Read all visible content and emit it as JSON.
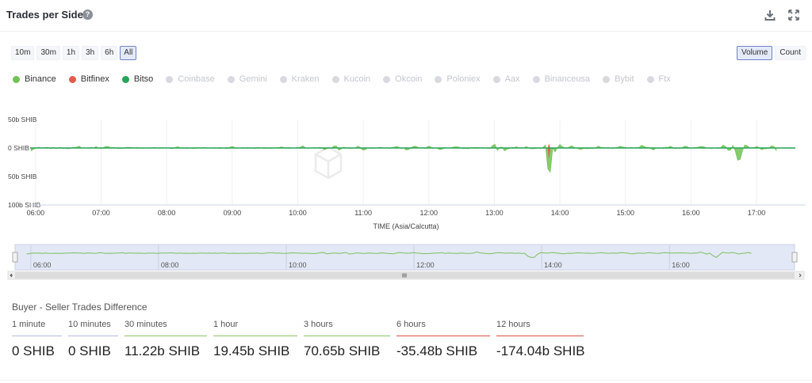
{
  "header": {
    "title": "Trades per Side",
    "help_icon": "question-circle-icon",
    "download_icon": "download-icon",
    "expand_icon": "expand-icon"
  },
  "timeframes": [
    {
      "label": "10m",
      "active": false
    },
    {
      "label": "30m",
      "active": false
    },
    {
      "label": "1h",
      "active": false
    },
    {
      "label": "3h",
      "active": false
    },
    {
      "label": "6h",
      "active": false
    },
    {
      "label": "All",
      "active": true
    }
  ],
  "modes": [
    {
      "label": "Volume",
      "active": true
    },
    {
      "label": "Count",
      "active": false
    }
  ],
  "legend": [
    {
      "name": "Binance",
      "color": "#72c255",
      "active": true
    },
    {
      "name": "Bitfinex",
      "color": "#e05c4b",
      "active": true
    },
    {
      "name": "Bitso",
      "color": "#27a459",
      "active": true
    },
    {
      "name": "Coinbase",
      "color": "#d8dadf",
      "active": false
    },
    {
      "name": "Gemini",
      "color": "#d8dadf",
      "active": false
    },
    {
      "name": "Kraken",
      "color": "#d8dadf",
      "active": false
    },
    {
      "name": "Kucoin",
      "color": "#d8dadf",
      "active": false
    },
    {
      "name": "Okcoin",
      "color": "#d8dadf",
      "active": false
    },
    {
      "name": "Poloniex",
      "color": "#d8dadf",
      "active": false
    },
    {
      "name": "Aax",
      "color": "#d8dadf",
      "active": false
    },
    {
      "name": "Binanceusa",
      "color": "#d8dadf",
      "active": false
    },
    {
      "name": "Bybit",
      "color": "#d8dadf",
      "active": false
    },
    {
      "name": "Ftx",
      "color": "#d8dadf",
      "active": false
    }
  ],
  "chart_data": {
    "type": "area",
    "title": "Trades per Side",
    "xlabel": "TIME (Asia/Calcutta)",
    "ylabel": "",
    "x_ticks": [
      "06:00",
      "07:00",
      "08:00",
      "09:00",
      "10:00",
      "11:00",
      "12:00",
      "13:00",
      "14:00",
      "15:00",
      "16:00",
      "17:00"
    ],
    "y_ticks": [
      "50b SHIB",
      "0 SHIB",
      "50b SHIB",
      "100b SHIB"
    ],
    "y_tick_values": [
      50,
      0,
      -50,
      -100
    ],
    "ylim": [
      -100,
      50
    ],
    "unit": "b SHIB",
    "xlim": [
      "05:55",
      "17:45"
    ],
    "data_end": "17:19",
    "grid": true,
    "series": [
      {
        "name": "Binance",
        "color": "#72c255",
        "baseline_noise_b": 1.2,
        "events": [
          {
            "time": "05:56",
            "value": -5
          },
          {
            "time": "06:40",
            "value": 2.5
          },
          {
            "time": "06:55",
            "value": 2
          },
          {
            "time": "07:05",
            "value": 2.5
          },
          {
            "time": "07:25",
            "value": 2.2
          },
          {
            "time": "08:10",
            "value": 2
          },
          {
            "time": "09:00",
            "value": 2
          },
          {
            "time": "09:45",
            "value": 3
          },
          {
            "time": "10:05",
            "value": 2.8
          },
          {
            "time": "10:25",
            "value": -3.5
          },
          {
            "time": "10:35",
            "value": 5
          },
          {
            "time": "10:38",
            "value": -5
          },
          {
            "time": "10:55",
            "value": 4
          },
          {
            "time": "11:00",
            "value": -5
          },
          {
            "time": "11:30",
            "value": 3.5
          },
          {
            "time": "11:40",
            "value": -4
          },
          {
            "time": "11:47",
            "value": 4
          },
          {
            "time": "12:00",
            "value": 3.5
          },
          {
            "time": "12:10",
            "value": -3
          },
          {
            "time": "12:25",
            "value": 3
          },
          {
            "time": "12:45",
            "value": 2
          },
          {
            "time": "13:00",
            "value": 10
          },
          {
            "time": "13:03",
            "value": -8
          },
          {
            "time": "13:05",
            "value": 5
          },
          {
            "time": "13:10",
            "value": -5
          },
          {
            "time": "13:20",
            "value": 3
          },
          {
            "time": "13:30",
            "value": 2.5
          },
          {
            "time": "13:49",
            "value": 25
          },
          {
            "time": "13:50",
            "value": -88
          },
          {
            "time": "13:52",
            "value": 8
          },
          {
            "time": "13:55",
            "value": -8
          },
          {
            "time": "14:00",
            "value": 5
          },
          {
            "time": "14:10",
            "value": 4
          },
          {
            "time": "14:20",
            "value": -3
          },
          {
            "time": "14:35",
            "value": 3
          },
          {
            "time": "14:55",
            "value": 3
          },
          {
            "time": "15:15",
            "value": 4
          },
          {
            "time": "15:25",
            "value": -3
          },
          {
            "time": "15:40",
            "value": 3
          },
          {
            "time": "15:55",
            "value": 5
          },
          {
            "time": "16:10",
            "value": 3
          },
          {
            "time": "16:30",
            "value": 7
          },
          {
            "time": "16:35",
            "value": -5
          },
          {
            "time": "16:40",
            "value": 8
          },
          {
            "time": "16:42",
            "value": -22
          },
          {
            "time": "16:45",
            "value": -18
          },
          {
            "time": "16:50",
            "value": 5
          },
          {
            "time": "17:00",
            "value": 4
          },
          {
            "time": "17:05",
            "value": -4
          },
          {
            "time": "17:15",
            "value": 5
          },
          {
            "time": "17:18",
            "value": -5
          }
        ]
      },
      {
        "name": "Bitfinex",
        "color": "#e05c4b",
        "events": [
          {
            "time": "13:50",
            "value": 8
          },
          {
            "time": "13:50",
            "value": -20
          }
        ]
      },
      {
        "name": "Bitso",
        "color": "#27a459",
        "values": "flat at 0 across full range"
      }
    ],
    "navigator": {
      "x_ticks": [
        "06:00",
        "08:00",
        "10:00",
        "12:00",
        "14:00",
        "16:00"
      ],
      "xlim": [
        "05:40",
        "18:05"
      ]
    }
  },
  "diff": {
    "title": "Buyer - Seller Trades Difference",
    "periods": [
      {
        "label": "1 minute",
        "value": "0 SHIB",
        "color": "#b7bbe0"
      },
      {
        "label": "10 minutes",
        "value": "0 SHIB",
        "color": "#b7bbe0"
      },
      {
        "label": "30 minutes",
        "value": "11.22b SHIB",
        "color": "#8bc46a"
      },
      {
        "label": "1 hour",
        "value": "19.45b SHIB",
        "color": "#8bc46a"
      },
      {
        "label": "3 hours",
        "value": "70.65b SHIB",
        "color": "#8bc46a"
      },
      {
        "label": "6 hours",
        "value": "-35.48b SHIB",
        "color": "#d9533e"
      },
      {
        "label": "12 hours",
        "value": "-174.04b SHIB",
        "color": "#d9533e"
      }
    ]
  }
}
